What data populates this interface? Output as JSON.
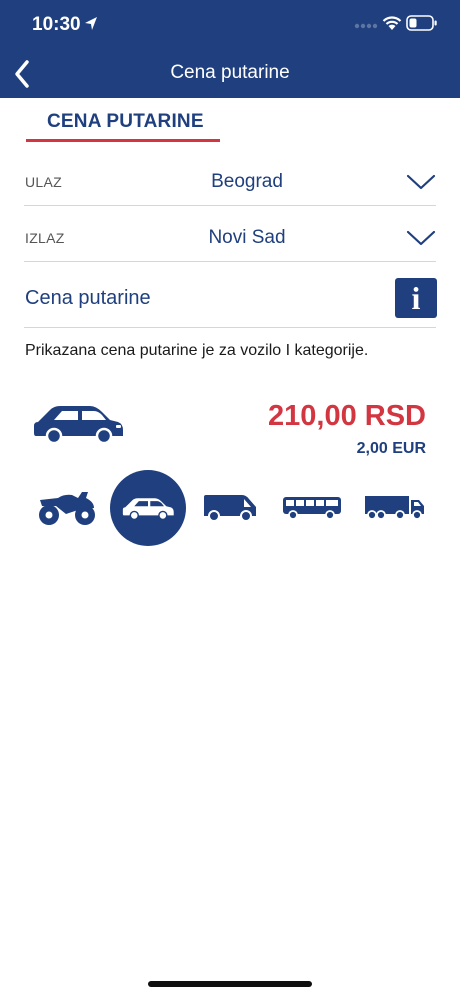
{
  "status": {
    "time": "10:30"
  },
  "nav": {
    "title": "Cena putarine",
    "back_icon": "chevron-left-icon"
  },
  "tab": {
    "label": "CENA PUTARINE"
  },
  "entry": {
    "label": "ULAZ",
    "value": "Beograd"
  },
  "exit": {
    "label": "IZLAZ",
    "value": "Novi Sad"
  },
  "price_section": {
    "title": "Cena putarine",
    "info_label": "i"
  },
  "note": "Prikazana cena putarine je za vozilo I kategorije.",
  "price": {
    "rsd": "210,00 RSD",
    "eur": "2,00 EUR"
  },
  "categories": [
    {
      "name": "motorcycle-icon",
      "active": false
    },
    {
      "name": "car-icon",
      "active": true
    },
    {
      "name": "van-icon",
      "active": false
    },
    {
      "name": "bus-icon",
      "active": false
    },
    {
      "name": "truck-icon",
      "active": false
    }
  ],
  "colors": {
    "primary": "#1f3f7e",
    "accent": "#d23641",
    "divider": "#d6d6d6"
  }
}
